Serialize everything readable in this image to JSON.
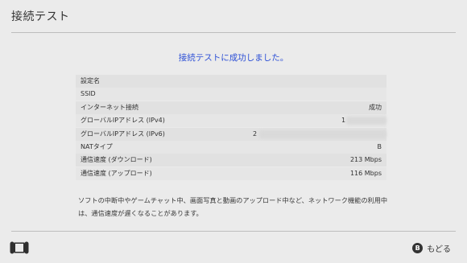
{
  "header": {
    "title": "接続テスト"
  },
  "message": "接続テストに成功しました。",
  "results": [
    {
      "label": "設定名",
      "value": ""
    },
    {
      "label": "SSID",
      "value": ""
    },
    {
      "label": "インターネット接続",
      "value": "成功"
    },
    {
      "label": "グローバルIPアドレス (IPv4)",
      "value": "1"
    },
    {
      "label": "グローバルIPアドレス (IPv6)",
      "value": "2"
    },
    {
      "label": "NATタイプ",
      "value": "B"
    },
    {
      "label": "通信速度 (ダウンロード)",
      "value": "213 Mbps"
    },
    {
      "label": "通信速度 (アップロード)",
      "value": "116 Mbps"
    }
  ],
  "note": "ソフトの中断中やゲームチャット中、画面写真と動画のアップロード中など、ネットワーク機能の利用中は、通信速度が遅くなることがあります。",
  "footer": {
    "back_button_glyph": "B",
    "back_label": "もどる"
  },
  "colors": {
    "background": "#ebebeb",
    "accent": "#2c4fd6",
    "text": "#2d2d2d"
  }
}
